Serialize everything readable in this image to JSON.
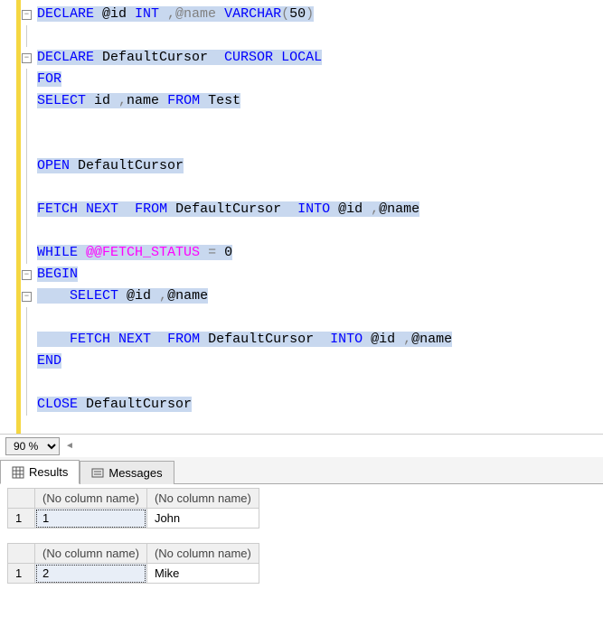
{
  "code": {
    "l1": {
      "a": "DECLARE",
      "b": " @id ",
      "c": "INT",
      "d": " ,@name ",
      "e": "VARCHAR",
      "f": "(",
      "g": "50",
      "h": ")"
    },
    "l3": {
      "a": "DECLARE",
      "b": " DefaultCursor  ",
      "c": "CURSOR",
      "d": " ",
      "e": "LOCAL"
    },
    "l4": {
      "a": "FOR"
    },
    "l5": {
      "a": "SELECT",
      "b": " id ",
      "c": ",",
      "d": "name ",
      "e": "FROM",
      "f": " Test"
    },
    "l8": {
      "a": "OPEN",
      "b": " DefaultCursor"
    },
    "l10": {
      "a": "FETCH",
      "b": " ",
      "c": "NEXT",
      "d": "  ",
      "e": "FROM",
      "f": " DefaultCursor  ",
      "g": "INTO",
      "h": " @id ",
      "i": ",",
      "j": "@name"
    },
    "l12": {
      "a": "WHILE",
      "b": " ",
      "c": "@@FETCH_STATUS",
      "d": " ",
      "e": "=",
      "f": " 0"
    },
    "l13": {
      "a": "BEGIN"
    },
    "l14": {
      "a": "    ",
      "b": "SELECT",
      "c": " @id ",
      "d": ",",
      "e": "@name"
    },
    "l16": {
      "a": "    ",
      "b": "FETCH",
      "c": " ",
      "d": "NEXT",
      "e": "  ",
      "f": "FROM",
      "g": " DefaultCursor  ",
      "h": "INTO",
      "i": " @id ",
      "j": ",",
      "k": "@name"
    },
    "l17": {
      "a": "END"
    },
    "l19": {
      "a": "CLOSE",
      "b": " DefaultCursor"
    }
  },
  "zoom": {
    "value": "90 %"
  },
  "tabs": {
    "results": "Results",
    "messages": "Messages"
  },
  "grids": [
    {
      "headers": [
        "(No column name)",
        "(No column name)"
      ],
      "rows": [
        {
          "n": "1",
          "cells": [
            "1",
            "John"
          ]
        }
      ]
    },
    {
      "headers": [
        "(No column name)",
        "(No column name)"
      ],
      "rows": [
        {
          "n": "1",
          "cells": [
            "2",
            "Mike"
          ]
        }
      ]
    }
  ]
}
